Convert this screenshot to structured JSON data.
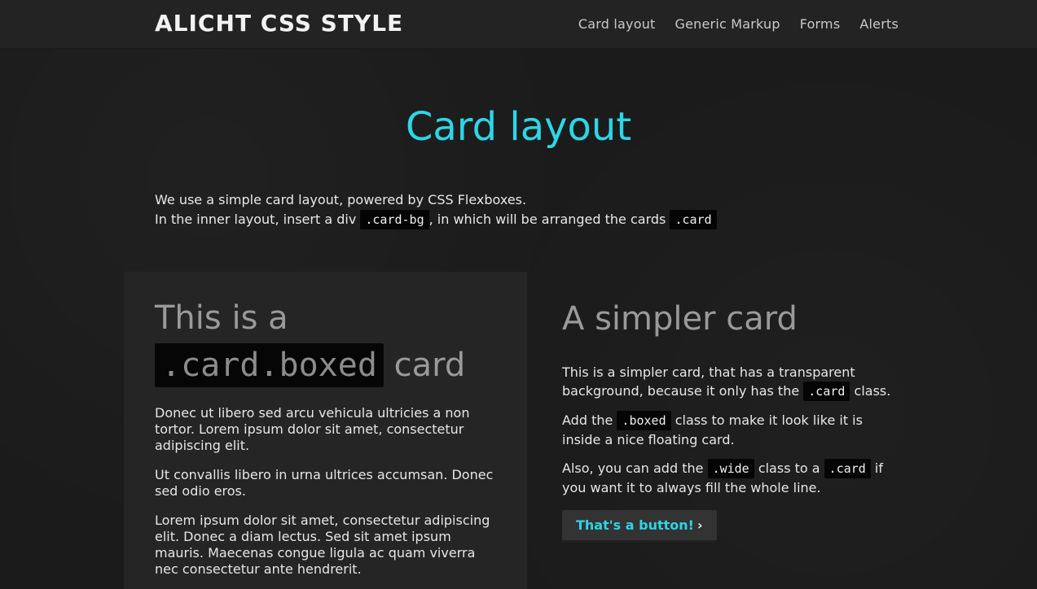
{
  "header": {
    "brand": "ALICHT CSS STYLE",
    "nav": [
      "Card layout",
      "Generic Markup",
      "Forms",
      "Alerts"
    ]
  },
  "main": {
    "title": "Card layout",
    "intro_line1": "We use a simple card layout, powered by CSS Flexboxes.",
    "intro_line2_a": "In the inner layout, insert a div",
    "intro_code_a": ".card-bg",
    "intro_line2_b": ", in which will be arranged the cards",
    "intro_code_b": ".card"
  },
  "card_boxed": {
    "title_a": "This is a",
    "title_code": ".card.boxed",
    "title_b": "card",
    "paragraphs": [
      "Donec ut libero sed arcu vehicula ultricies a non tortor. Lorem ipsum dolor sit amet, consectetur adipiscing elit.",
      "Ut convallis libero in urna ultrices accumsan. Donec sed odio eros.",
      "Lorem ipsum dolor sit amet, consectetur adipiscing elit. Donec a diam lectus. Sed sit amet ipsum mauris. Maecenas congue ligula ac quam viverra nec consectetur ante hendrerit."
    ]
  },
  "card_simple": {
    "title": "A simpler card",
    "p1_a": "This is a simpler card, that has a transparent background, because it only has the",
    "p1_code": ".card",
    "p1_b": "class.",
    "p2_a": "Add the",
    "p2_code": ".boxed",
    "p2_b": "class to make it look like it is inside a nice floating card.",
    "p3_a": "Also, you can add the",
    "p3_code_a": ".wide",
    "p3_b": "class to a",
    "p3_code_b": ".card",
    "p3_c": "if you want it to always fill the whole line.",
    "button_label": "That's a button!",
    "button_icon": "chevron-right-icon"
  },
  "colors": {
    "accent": "#2dd6e6",
    "background": "#1b1b1b",
    "card": "#252525",
    "code_bg": "#050505"
  }
}
